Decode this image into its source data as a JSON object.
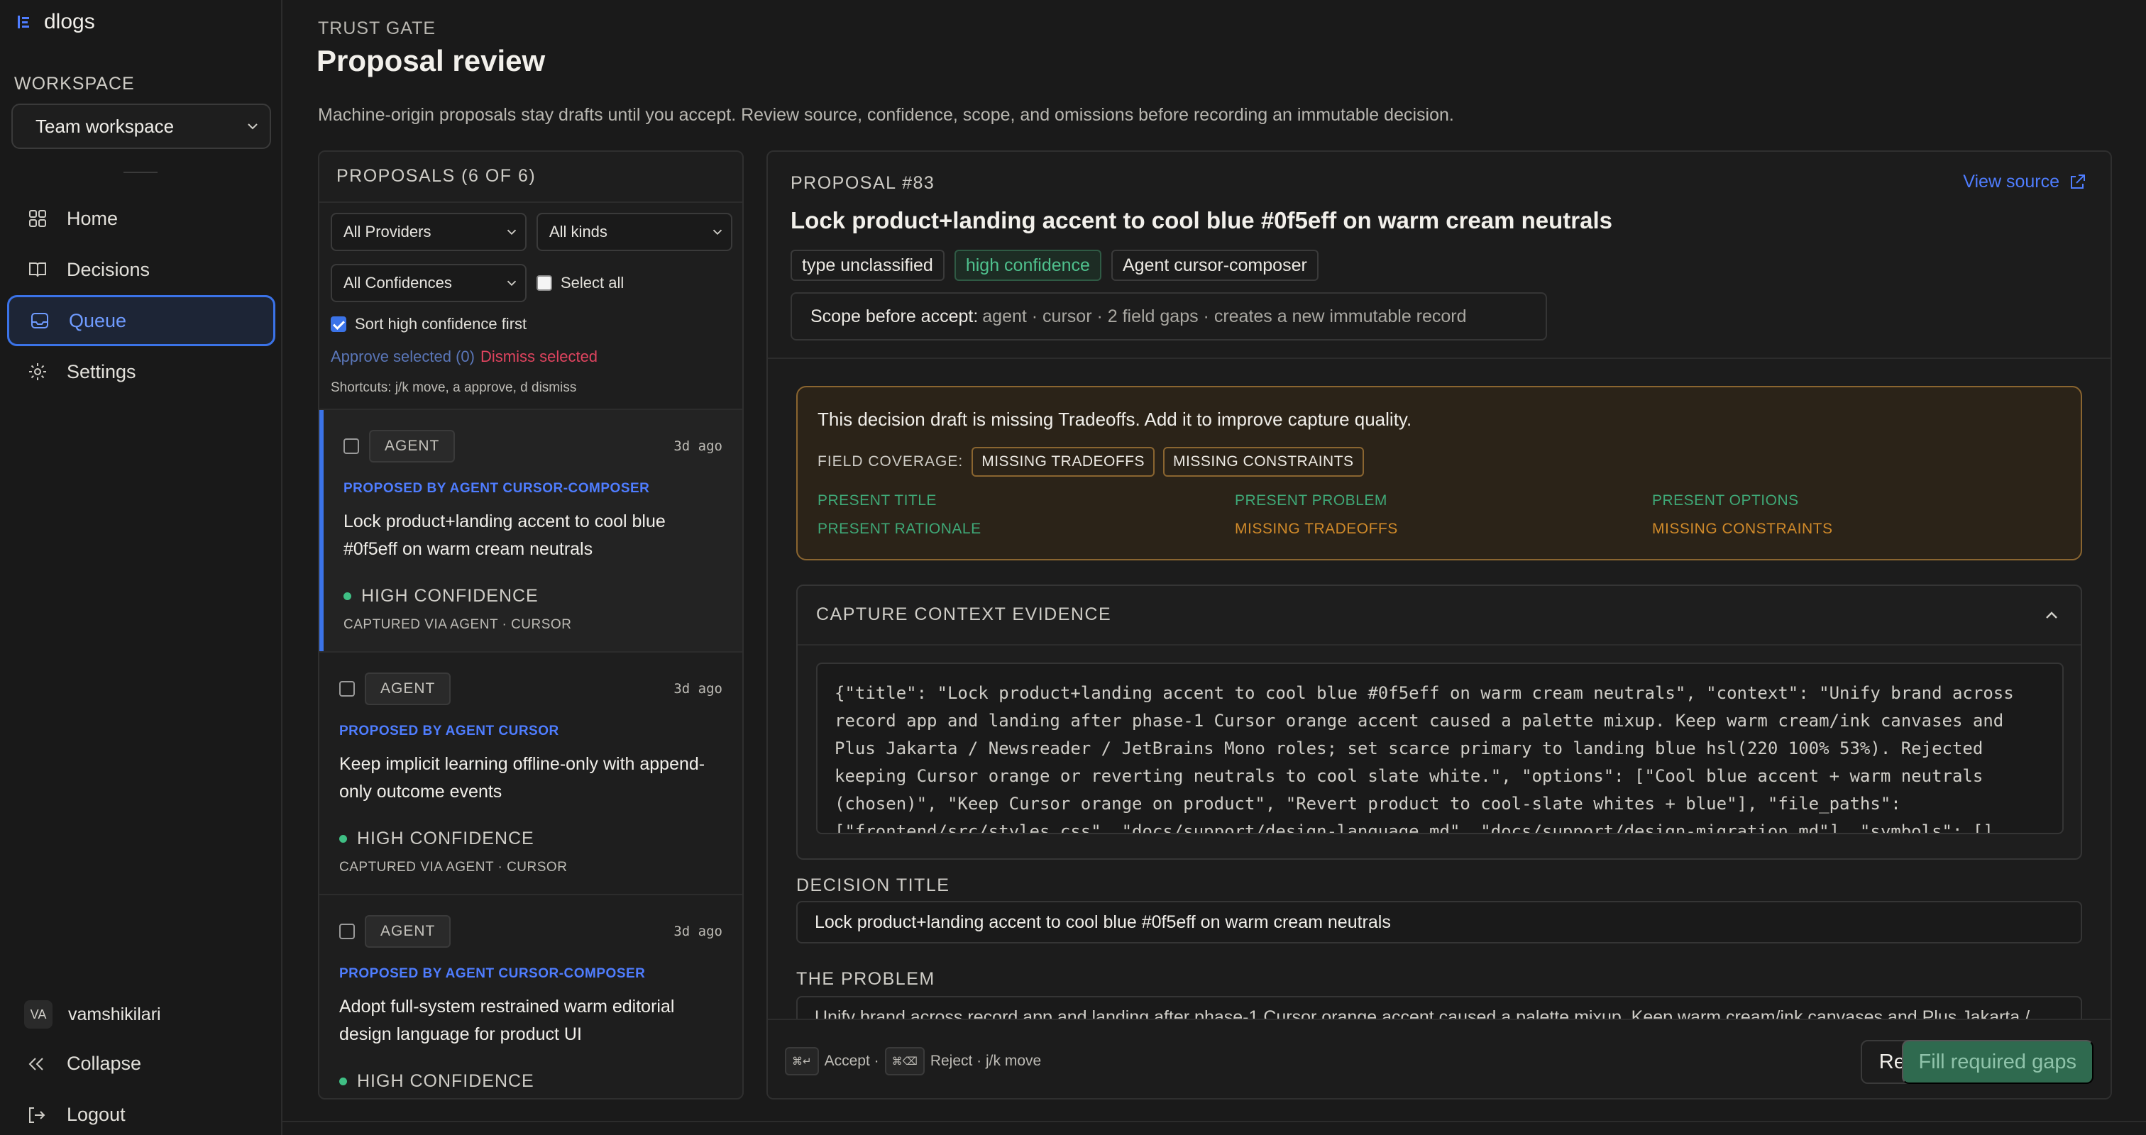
{
  "app": {
    "name": "dlogs",
    "logo_icon": "dlogs-logo-icon",
    "accent": "#3b73e8"
  },
  "sidebar": {
    "workspace_label": "WORKSPACE",
    "workspace_value": "Team workspace",
    "nav": [
      {
        "label": "Home",
        "icon": "home-icon"
      },
      {
        "label": "Decisions",
        "icon": "book-icon"
      },
      {
        "label": "Queue",
        "icon": "inbox-icon",
        "active": true
      },
      {
        "label": "Settings",
        "icon": "gear-icon"
      }
    ],
    "user": {
      "initials": "VA",
      "name": "vamshikilari"
    },
    "collapse_label": "Collapse",
    "logout_label": "Logout"
  },
  "header": {
    "eyebrow": "TRUST GATE",
    "title": "Proposal review",
    "description": "Machine-origin proposals stay drafts until you accept. Review source, confidence, scope, and omissions before recording an immutable decision."
  },
  "list": {
    "heading": "PROPOSALS (6 OF 6)",
    "filters": {
      "provider": "All Providers",
      "kind": "All kinds",
      "confidence": "All Confidences"
    },
    "select_all_label": "Select all",
    "sort_label": "Sort high confidence first",
    "sort_checked": true,
    "approve_selected": "Approve selected (0)",
    "dismiss_selected": "Dismiss selected",
    "shortcuts": "Shortcuts: j/k move, a approve, d dismiss",
    "items": [
      {
        "badge": "AGENT",
        "time": "3d ago",
        "proposed_by": "PROPOSED BY AGENT CURSOR-COMPOSER",
        "title": "Lock product+landing accent to cool blue #0f5eff on warm cream neutrals",
        "confidence": "HIGH CONFIDENCE",
        "via": "CAPTURED VIA AGENT · CURSOR",
        "selected": true
      },
      {
        "badge": "AGENT",
        "time": "3d ago",
        "proposed_by": "PROPOSED BY AGENT CURSOR",
        "title": "Keep implicit learning offline-only with append-only outcome events",
        "confidence": "HIGH CONFIDENCE",
        "via": "CAPTURED VIA AGENT · CURSOR"
      },
      {
        "badge": "AGENT",
        "time": "3d ago",
        "proposed_by": "PROPOSED BY AGENT CURSOR-COMPOSER",
        "title": "Adopt full-system restrained warm editorial design language for product UI",
        "confidence": "HIGH CONFIDENCE",
        "via": ""
      }
    ]
  },
  "detail": {
    "eyebrow": "PROPOSAL #83",
    "view_source": "View source",
    "title": "Lock product+landing accent to cool blue #0f5eff on warm cream neutrals",
    "chips": [
      "type unclassified",
      "high confidence",
      "Agent cursor-composer"
    ],
    "scope_label": "Scope before accept:",
    "scope_value": "agent · cursor · 2 field gaps · creates a new immutable record",
    "warning": {
      "message": "This decision draft is missing Tradeoffs. Add it to improve capture quality.",
      "coverage_label": "FIELD COVERAGE:",
      "coverage_chips": [
        "MISSING TRADEOFFS",
        "MISSING CONSTRAINTS"
      ],
      "fields": [
        {
          "text": "PRESENT TITLE",
          "status": "present"
        },
        {
          "text": "PRESENT PROBLEM",
          "status": "present"
        },
        {
          "text": "PRESENT OPTIONS",
          "status": "present"
        },
        {
          "text": "PRESENT RATIONALE",
          "status": "present"
        },
        {
          "text": "MISSING TRADEOFFS",
          "status": "missing"
        },
        {
          "text": "MISSING CONSTRAINTS",
          "status": "missing"
        }
      ]
    },
    "evidence": {
      "heading": "CAPTURE CONTEXT EVIDENCE",
      "code": "{\"title\": \"Lock product+landing accent to cool blue #0f5eff on warm cream neutrals\", \"context\": \"Unify brand across record app and landing after phase-1 Cursor orange accent caused a palette mixup. Keep warm cream/ink canvases and Plus Jakarta / Newsreader / JetBrains Mono roles; set scarce primary to landing blue hsl(220 100% 53%). Rejected keeping Cursor orange or reverting neutrals to cool slate white.\", \"options\": [\"Cool blue accent + warm neutrals (chosen)\", \"Keep Cursor orange on product\", \"Revert product to cool-slate whites + blue\"], \"file_paths\": [\"frontend/src/styles.css\", \"docs/support/design-language.md\", \"docs/support/design-migration.md\"], \"symbols\": []"
    },
    "decision_title_label": "DECISION TITLE",
    "decision_title_value": "Lock product+landing accent to cool blue #0f5eff on warm cream neutrals",
    "problem_label": "THE PROBLEM",
    "problem_value": "Unify brand across record app and landing after phase-1 Cursor orange accent caused a palette mixup. Keep warm cream/ink canvases and Plus Jakarta /",
    "footer": {
      "accept_key": "⌘↵",
      "accept_label": "Accept ·",
      "reject_key": "⌘⌫",
      "reject_label": "Reject · j/k move",
      "reject_button": "Reject",
      "fill_button": "Fill required gaps"
    }
  }
}
